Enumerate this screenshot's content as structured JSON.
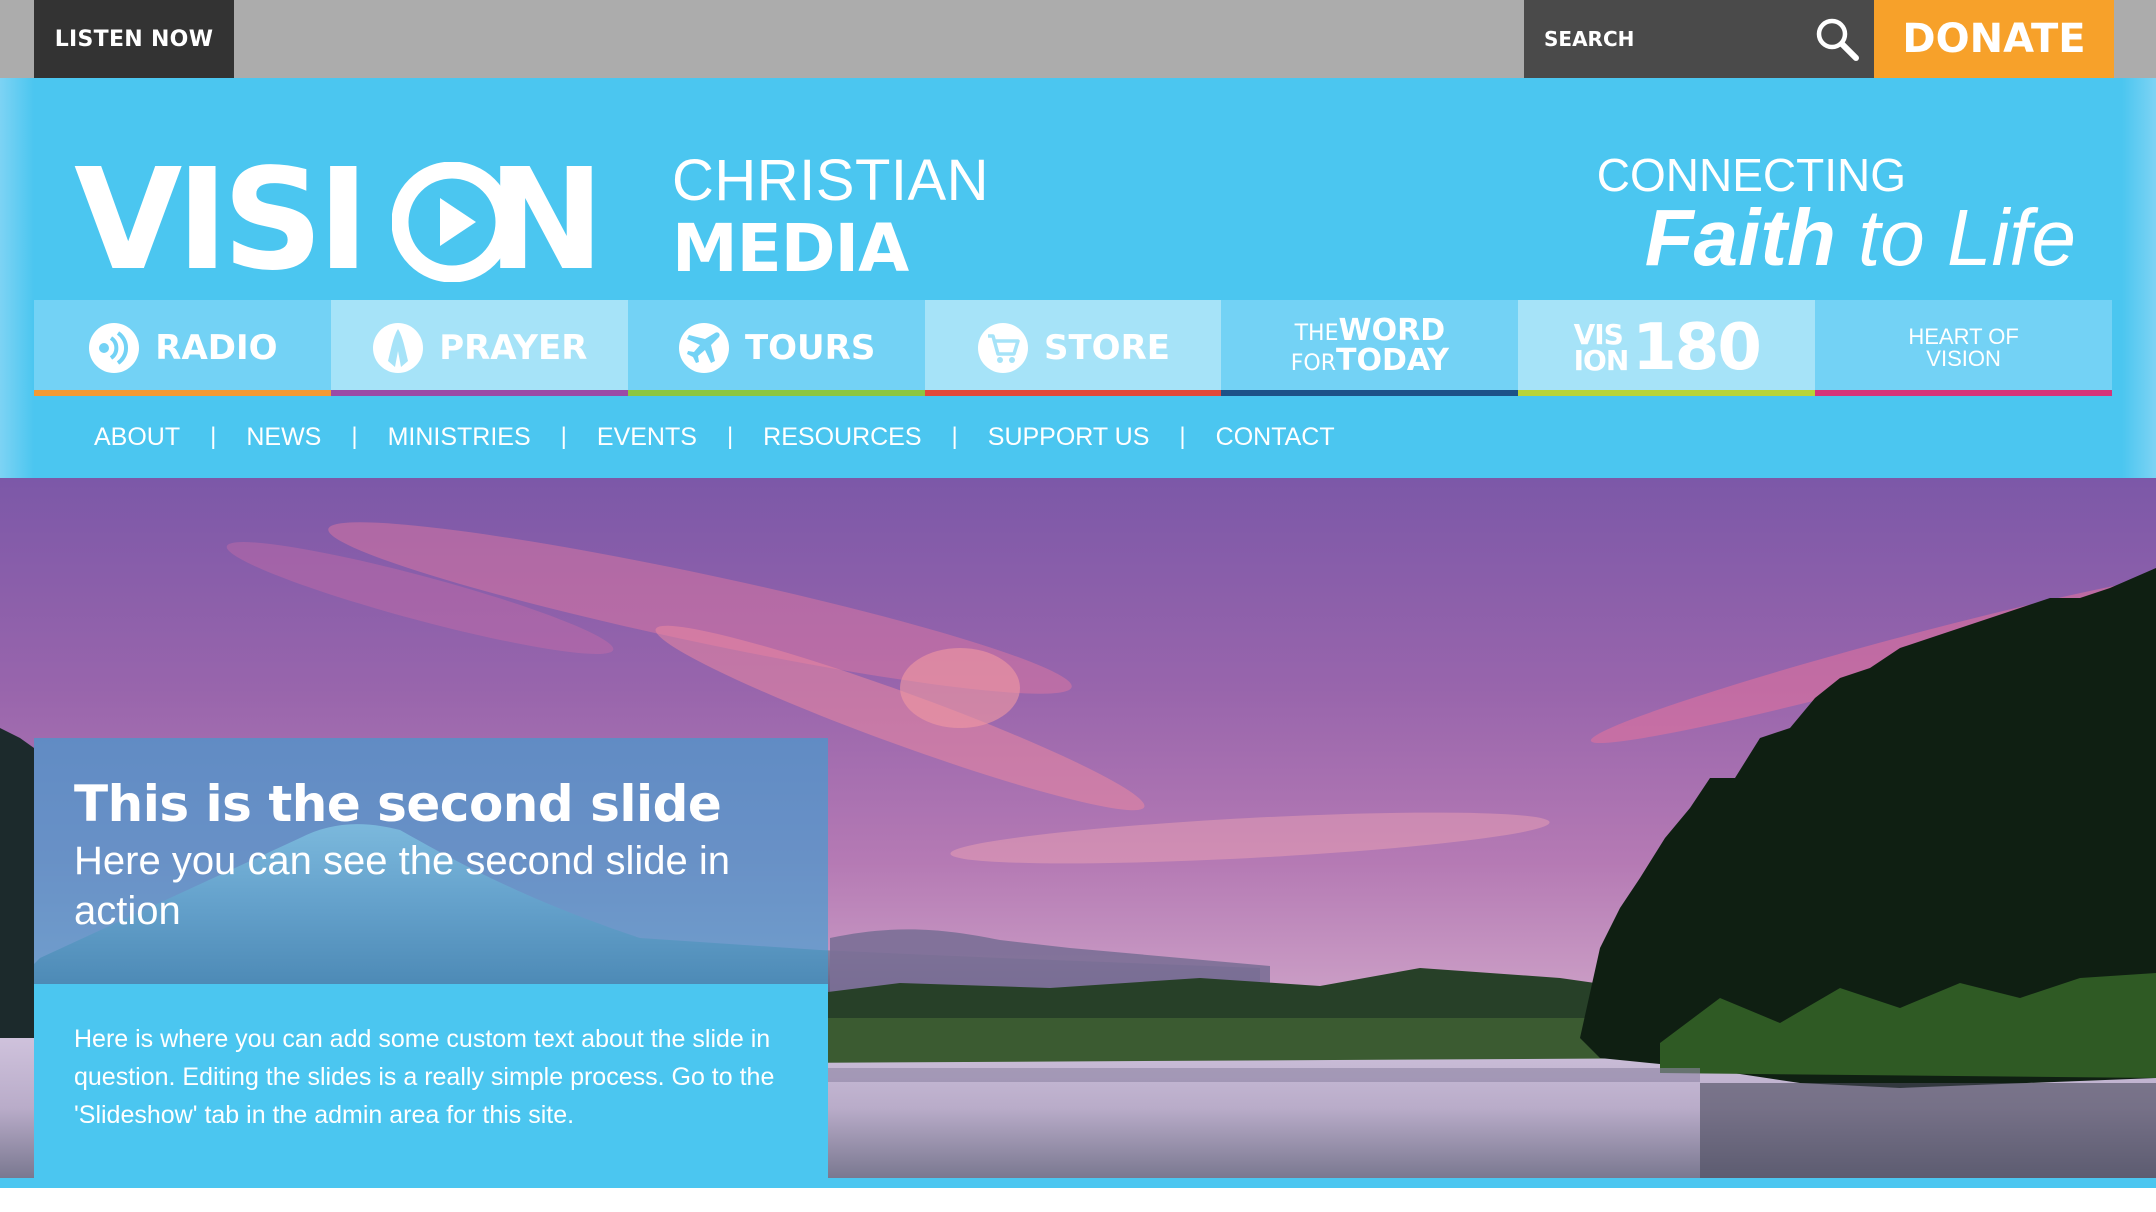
{
  "topbar": {
    "listen_now": "LISTEN NOW",
    "search_placeholder": "SEARCH",
    "donate": "DONATE"
  },
  "header": {
    "logo_vision": "VISI",
    "logo_vision_end": "N",
    "logo_christian": "CHRISTIAN",
    "logo_media": "MEDIA",
    "tagline_line1": "CONNECTING",
    "tagline_faith": "Faith",
    "tagline_rest": " to Life"
  },
  "category_nav": [
    {
      "label": "RADIO",
      "icon": "radio-icon",
      "bg": "#73d2f5",
      "bar": "#f39a33"
    },
    {
      "label": "PRAYER",
      "icon": "prayer-icon",
      "bg": "#a6e3f8",
      "bar": "#9b4aa6"
    },
    {
      "label": "TOURS",
      "icon": "plane-icon",
      "bg": "#73d2f5",
      "bar": "#8cc63f"
    },
    {
      "label": "STORE",
      "icon": "cart-icon",
      "bg": "#a6e3f8",
      "bar": "#e2493a"
    },
    {
      "label_sm1": "THE",
      "label_lg1": "WORD",
      "label_sm2": "FOR",
      "label_lg2": "TODAY",
      "bg": "#73d2f5",
      "bar": "#1d5187"
    },
    {
      "label_small1": "VIS",
      "label_small2": "ION",
      "label_big": "180",
      "bg": "#a6e3f8",
      "bar": "#b9d437"
    },
    {
      "label1": "HEART OF",
      "label2": "VISION",
      "bg": "#73d2f5",
      "bar": "#d6357a"
    }
  ],
  "sub_nav": [
    "ABOUT",
    "NEWS",
    "MINISTRIES",
    "EVENTS",
    "RESOURCES",
    "SUPPORT US",
    "CONTACT"
  ],
  "slide": {
    "title": "This is the second slide",
    "subtitle": "Here you can see the second slide in action",
    "body": "Here is where you can add some custom text about the slide in question. Editing the slides is a really simple process. Go to the 'Slideshow' tab in the admin area for this site."
  },
  "colors": {
    "brand_blue": "#4bc6f0",
    "donate_orange": "#f7a12a",
    "topbar_gray": "#acacac",
    "dark_gray": "#333333"
  }
}
